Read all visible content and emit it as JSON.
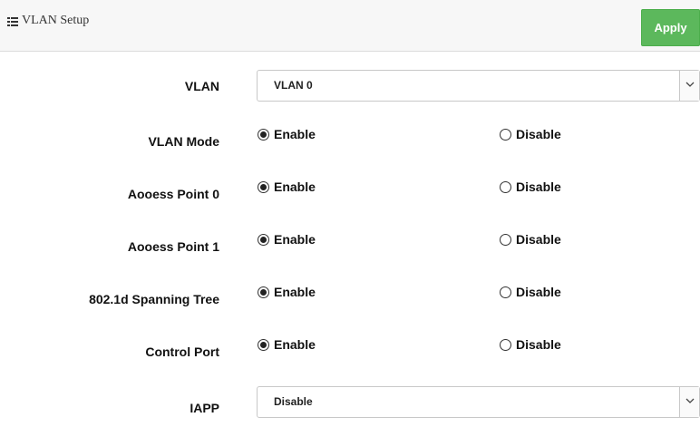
{
  "header": {
    "title": "VLAN Setup",
    "icon": "list-icon",
    "apply_label": "Apply",
    "apply_color": "#5cb85c"
  },
  "vlan": {
    "label": "VLAN",
    "selected": "VLAN 0"
  },
  "radio_rows": [
    {
      "label": "VLAN Mode",
      "enable": "Enable",
      "disable": "Disable",
      "selected": "Enable"
    },
    {
      "label": "Aooess Point 0",
      "enable": "Enable",
      "disable": "Disable",
      "selected": "Enable"
    },
    {
      "label": "Aooess Point 1",
      "enable": "Enable",
      "disable": "Disable",
      "selected": "Enable"
    },
    {
      "label": "802.1d Spanning Tree",
      "enable": "Enable",
      "disable": "Disable",
      "selected": "Enable"
    },
    {
      "label": "Control Port",
      "enable": "Enable",
      "disable": "Disable",
      "selected": "Enable"
    }
  ],
  "iapp": {
    "label": "IAPP",
    "selected": "Disable"
  }
}
